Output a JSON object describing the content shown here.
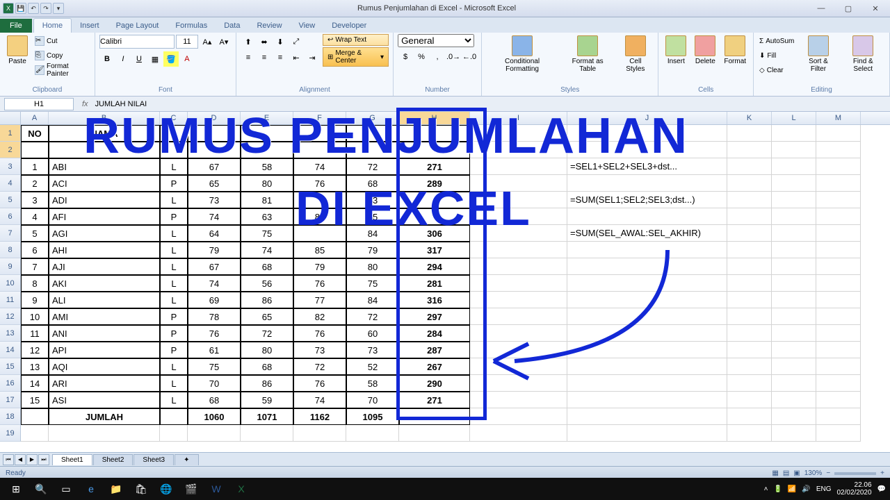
{
  "window": {
    "title": "Rumus Penjumlahan di Excel - Microsoft Excel"
  },
  "tabs": {
    "file": "File",
    "home": "Home",
    "insert": "Insert",
    "page": "Page Layout",
    "formulas": "Formulas",
    "data": "Data",
    "review": "Review",
    "view": "View",
    "developer": "Developer"
  },
  "ribbon": {
    "clipboard": {
      "label": "Clipboard",
      "paste": "Paste",
      "cut": "Cut",
      "copy": "Copy",
      "fmtp": "Format Painter"
    },
    "font": {
      "label": "Font",
      "name": "Calibri",
      "size": "11"
    },
    "alignment": {
      "label": "Alignment",
      "wrap": "Wrap Text",
      "merge": "Merge & Center"
    },
    "number": {
      "label": "Number",
      "format": "General"
    },
    "styles": {
      "label": "Styles",
      "cf": "Conditional\nFormatting",
      "fat": "Format\nas Table",
      "cs": "Cell\nStyles"
    },
    "cells": {
      "label": "Cells",
      "ins": "Insert",
      "del": "Delete",
      "fmt": "Format"
    },
    "editing": {
      "label": "Editing",
      "autosum": "AutoSum",
      "fill": "Fill",
      "clear": "Clear",
      "sort": "Sort &\nFilter",
      "find": "Find &\nSelect"
    }
  },
  "namebox": "H1",
  "formula": "JUMLAH NILAI",
  "columns": [
    "A",
    "B",
    "C",
    "D",
    "E",
    "F",
    "G",
    "H",
    "I",
    "J",
    "K",
    "L",
    "M"
  ],
  "headers": {
    "no": "NO",
    "nama": "NAMA",
    "jumlah": "JUMLAH"
  },
  "formulas_text": {
    "f1": "=SEL1+SEL2+SEL3+dst...",
    "f2": "=SUM(SEL1;SEL2;SEL3;dst...)",
    "f3": "=SUM(SEL_AWAL:SEL_AKHIR)"
  },
  "footer_label": "JUMLAH",
  "footer": [
    1060,
    1071,
    1162,
    1095
  ],
  "data": [
    {
      "no": 1,
      "nama": "ABI",
      "c": "L",
      "t": [
        67,
        58,
        74,
        72
      ],
      "j": 271
    },
    {
      "no": 2,
      "nama": "ACI",
      "c": "P",
      "t": [
        65,
        80,
        76,
        68
      ],
      "j": 289
    },
    {
      "no": 3,
      "nama": "ADI",
      "c": "L",
      "t": [
        73,
        81,
        "",
        83
      ],
      "j": ""
    },
    {
      "no": 4,
      "nama": "AFI",
      "c": "P",
      "t": [
        74,
        63,
        84,
        85
      ],
      "j": ""
    },
    {
      "no": 5,
      "nama": "AGI",
      "c": "L",
      "t": [
        64,
        75,
        "",
        84
      ],
      "j": 306
    },
    {
      "no": 6,
      "nama": "AHI",
      "c": "L",
      "t": [
        79,
        74,
        85,
        79
      ],
      "j": 317
    },
    {
      "no": 7,
      "nama": "AJI",
      "c": "L",
      "t": [
        67,
        68,
        79,
        80
      ],
      "j": 294
    },
    {
      "no": 8,
      "nama": "AKI",
      "c": "L",
      "t": [
        74,
        56,
        76,
        75
      ],
      "j": 281
    },
    {
      "no": 9,
      "nama": "ALI",
      "c": "L",
      "t": [
        69,
        86,
        77,
        84
      ],
      "j": 316
    },
    {
      "no": 10,
      "nama": "AMI",
      "c": "P",
      "t": [
        78,
        65,
        82,
        72
      ],
      "j": 297
    },
    {
      "no": 11,
      "nama": "ANI",
      "c": "P",
      "t": [
        76,
        72,
        76,
        60
      ],
      "j": 284
    },
    {
      "no": 12,
      "nama": "API",
      "c": "P",
      "t": [
        61,
        80,
        73,
        73
      ],
      "j": 287
    },
    {
      "no": 13,
      "nama": "AQI",
      "c": "L",
      "t": [
        75,
        68,
        72,
        52
      ],
      "j": 267
    },
    {
      "no": 14,
      "nama": "ARI",
      "c": "L",
      "t": [
        70,
        86,
        76,
        58
      ],
      "j": 290
    },
    {
      "no": 15,
      "nama": "ASI",
      "c": "L",
      "t": [
        68,
        59,
        74,
        70
      ],
      "j": 271
    }
  ],
  "overlay": {
    "line1": "RUMUS PENJUMLAHAN",
    "line2": "DI EXCEL"
  },
  "sheets": [
    "Sheet1",
    "Sheet2",
    "Sheet3"
  ],
  "status": {
    "ready": "Ready",
    "zoom": "130%"
  },
  "taskbar": {
    "lang": "ENG",
    "time": "22.06",
    "date": "02/02/2020"
  }
}
